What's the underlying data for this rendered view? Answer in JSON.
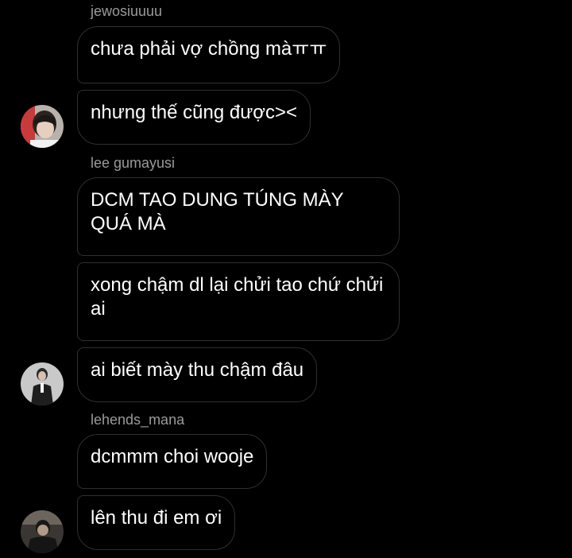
{
  "messages": [
    {
      "username": "jewosiuuuu",
      "bubbles": [
        "chưa phải vợ chồng màㅠㅠ",
        "nhưng thế cũng được><"
      ]
    },
    {
      "username": "lee gumayusi",
      "bubbles": [
        "DCM TAO DUNG TÚNG MÀY QUÁ MÀ",
        "xong chậm dl lại chửi tao chứ chửi ai",
        "ai biết mày thu chậm đâu"
      ]
    },
    {
      "username": "lehends_mana",
      "bubbles": [
        "dcmmm choi wooje",
        "lên thu đi em ơi"
      ]
    }
  ],
  "colors": {
    "background": "#000000",
    "bubble_border": "#2f2f2f",
    "username": "#9a9a9a",
    "text": "#ffffff"
  }
}
